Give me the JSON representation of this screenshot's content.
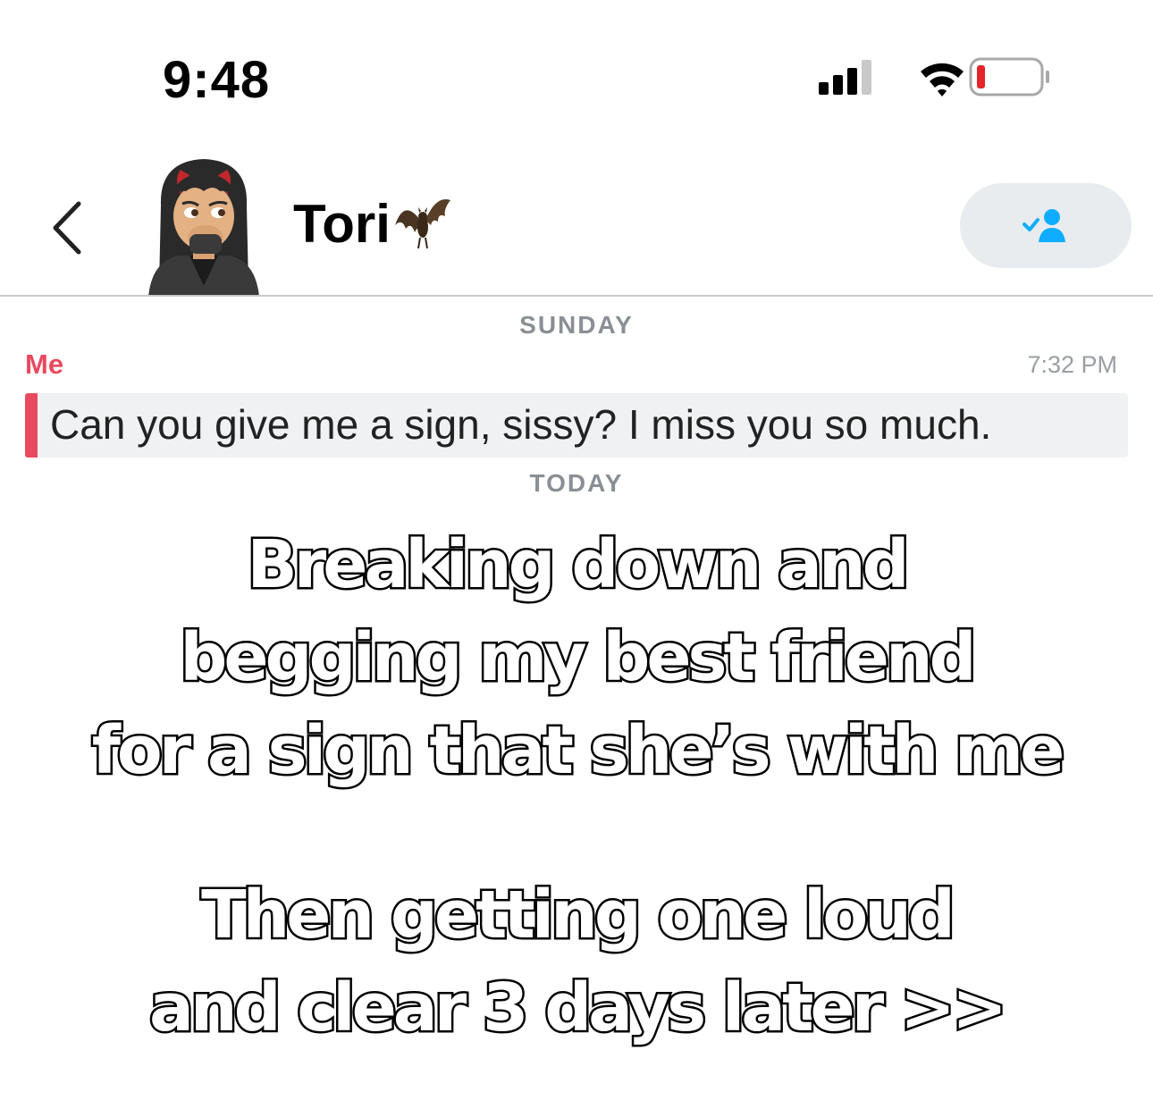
{
  "status_bar": {
    "time": "9:48",
    "icons": [
      "signal-icon",
      "wifi-icon",
      "battery-icon"
    ],
    "battery_color": "#e5252a"
  },
  "header": {
    "back_icon": "chevron-left-icon",
    "contact_name": "Tori",
    "contact_emoji": "bat",
    "friend_button_icon": "friend-check-icon",
    "accent_color": "#0fadff"
  },
  "conversation": {
    "separator_1": "SUNDAY",
    "message": {
      "sender": "Me",
      "time": "7:32 PM",
      "text": "Can you give me a sign, sissy? I miss you so much.",
      "accent_color": "#e84a5f"
    },
    "separator_2": "TODAY"
  },
  "overlay": {
    "line1": "Breaking down and",
    "line2": "begging my best friend",
    "line3": "for a sign that she’s with me",
    "line4": "Then getting one loud",
    "line5": "and clear 3 days later >>"
  }
}
